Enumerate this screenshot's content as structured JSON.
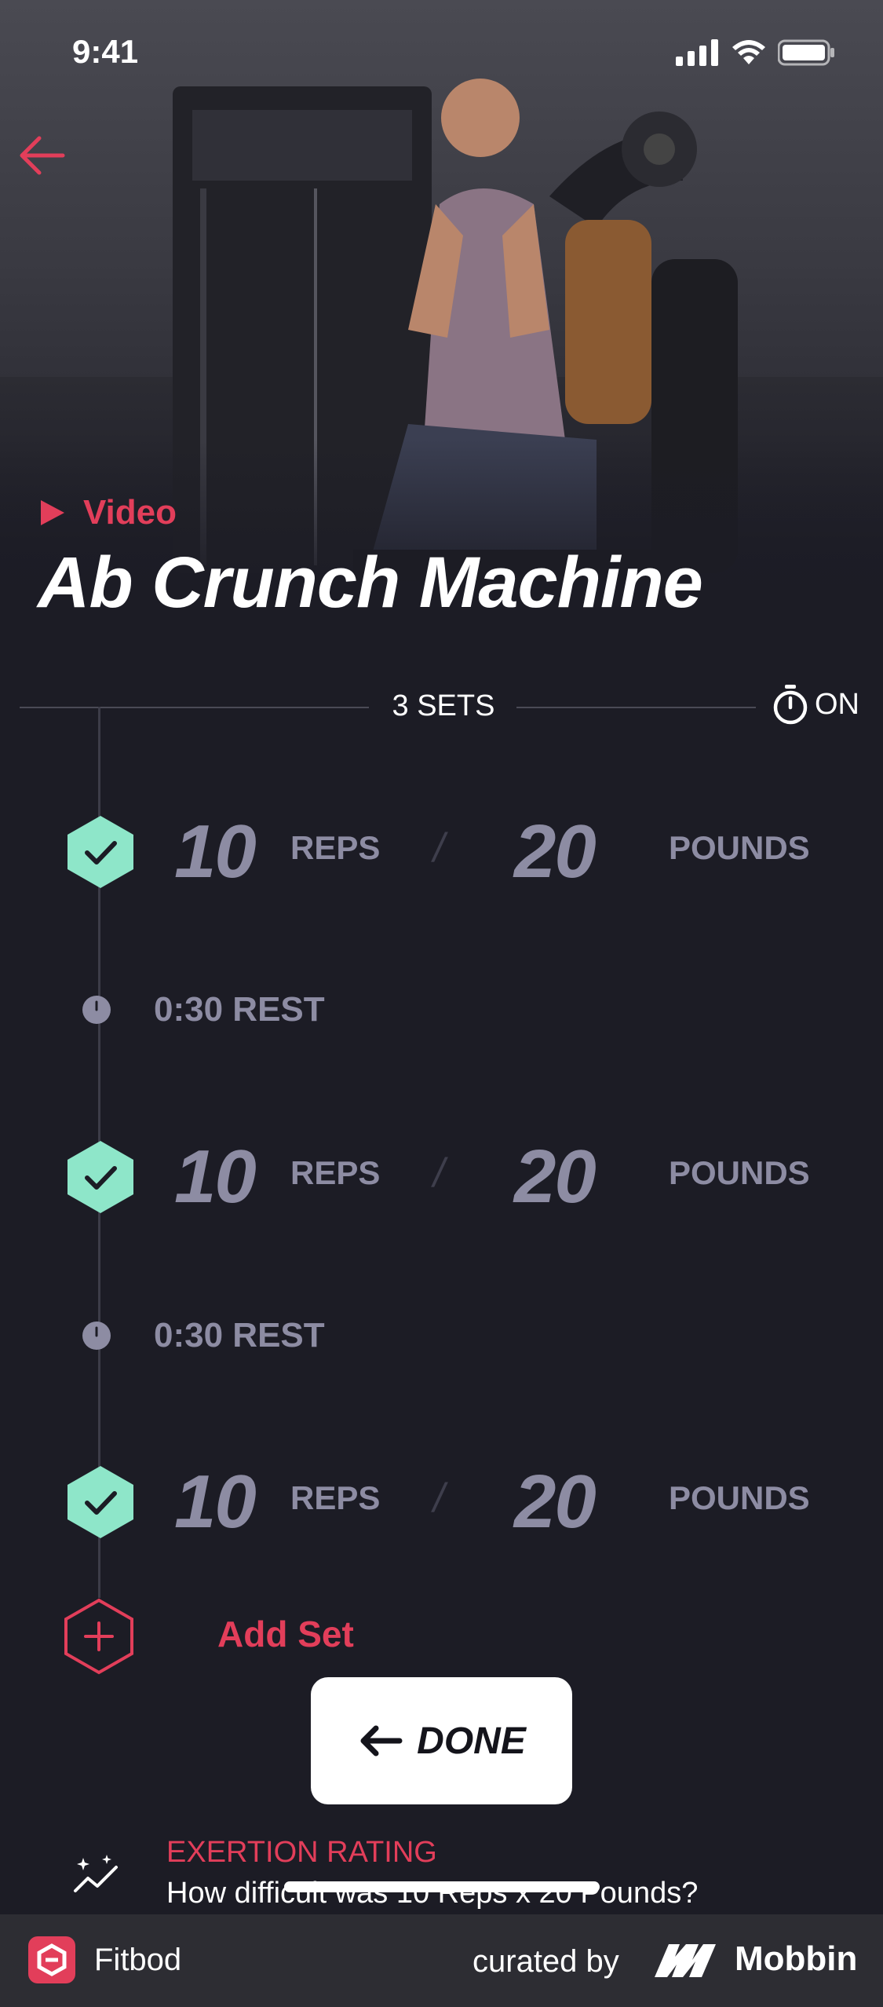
{
  "status_bar": {
    "time": "9:41"
  },
  "header": {
    "video_label": "Video",
    "title": "Ab Crunch Machine"
  },
  "summary": {
    "sets_label": "3 SETS",
    "timer_state": "ON"
  },
  "sets": [
    {
      "reps": "10",
      "reps_unit": "REPS",
      "weight": "20",
      "weight_unit": "POUNDS",
      "completed": true
    },
    {
      "reps": "10",
      "reps_unit": "REPS",
      "weight": "20",
      "weight_unit": "POUNDS",
      "completed": true
    },
    {
      "reps": "10",
      "reps_unit": "REPS",
      "weight": "20",
      "weight_unit": "POUNDS",
      "completed": true
    }
  ],
  "rests": [
    {
      "label": "0:30 REST"
    },
    {
      "label": "0:30 REST"
    }
  ],
  "actions": {
    "add_set": "Add Set",
    "done": "DONE"
  },
  "exertion": {
    "title": "EXERTION RATING",
    "question": "How difficult was 10 Reps x 20 Pounds?"
  },
  "footer": {
    "app_name": "Fitbod",
    "curated_by": "curated by",
    "brand": "Mobbin"
  },
  "colors": {
    "accent": "#e23e5a",
    "check": "#8ee6c9",
    "muted": "#8d8ca3",
    "background": "#1c1c25"
  }
}
